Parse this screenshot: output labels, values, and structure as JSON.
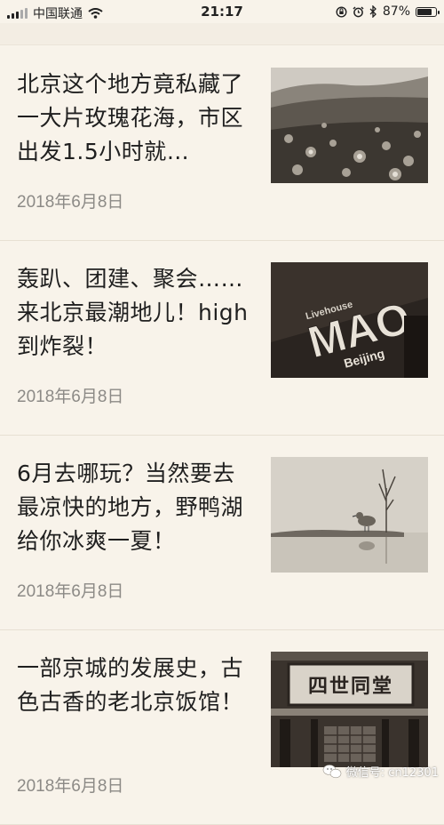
{
  "status_bar": {
    "carrier": "中国联通",
    "time": "21:17",
    "battery": "87%",
    "battery_level": 0.87,
    "icons": [
      "signal-icon",
      "wifi-icon",
      "lock-rotation-icon",
      "alarm-icon",
      "bluetooth-icon",
      "battery-icon"
    ]
  },
  "articles": [
    {
      "title": "北京这个地方竟私藏了一大片玫瑰花海，市区出发1.5小时就…",
      "date": "2018年6月8日",
      "thumb": "flower-field"
    },
    {
      "title": "轰趴、团建、聚会……来北京最潮地儿！high到炸裂！",
      "date": "2018年6月8日",
      "thumb": "livehouse-mao"
    },
    {
      "title": "6月去哪玩？当然要去最凉快的地方，野鸭湖给你冰爽一夏！",
      "date": "2018年6月8日",
      "thumb": "lake-bird"
    },
    {
      "title": "一部京城的发展史，古色古香的老北京饭馆！",
      "date": "2018年6月8日",
      "thumb": "old-restaurant"
    }
  ],
  "thumb_text": {
    "sign_small": "Livehouse",
    "sign_big": "MAO",
    "sign_city": "Beijing",
    "restaurant_sign": "四世同堂"
  },
  "watermark": {
    "text": "微信号: cn12301",
    "icon": "wechat-icon"
  }
}
